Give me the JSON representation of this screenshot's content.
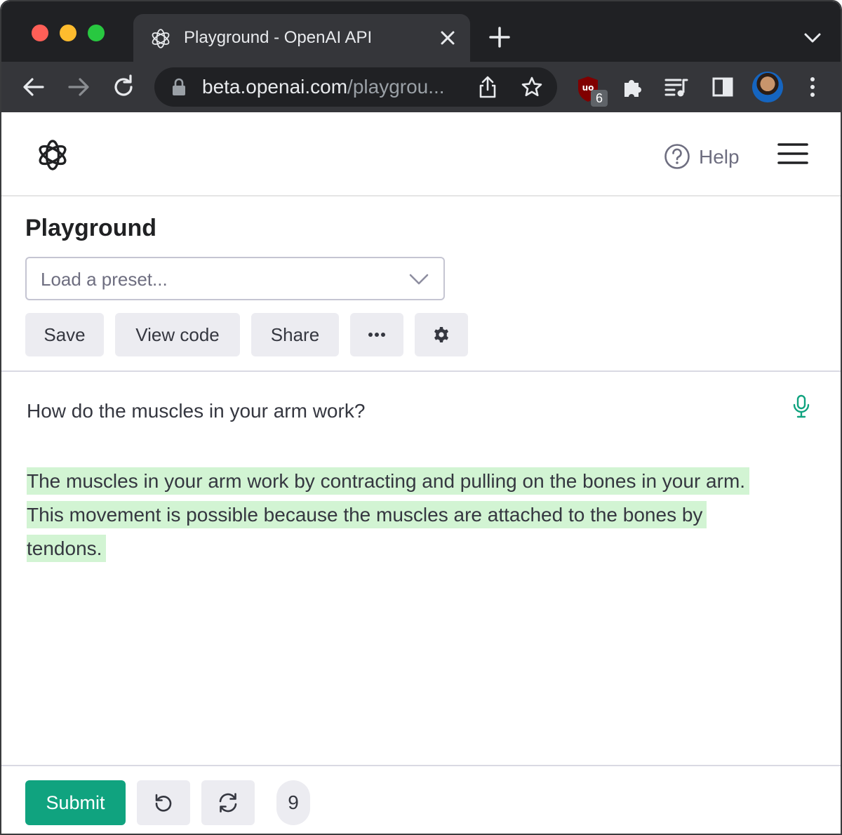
{
  "browser": {
    "tab_title": "Playground - OpenAI API",
    "url_host": "beta.openai.com",
    "url_path": "/playgrou...",
    "extension_badge": "6"
  },
  "header": {
    "help_label": "Help"
  },
  "controls": {
    "title": "Playground",
    "preset_placeholder": "Load a preset...",
    "save_label": "Save",
    "view_code_label": "View code",
    "share_label": "Share"
  },
  "editor": {
    "prompt": "How do the muscles in your arm work?",
    "completion": "The muscles in your arm work by contracting and pulling on the bones in your arm. This movement is possible because the muscles are attached to the bones by tendons."
  },
  "footer": {
    "submit_label": "Submit",
    "token_count": "9"
  },
  "colors": {
    "accent": "#10a37f",
    "highlight": "#d2f4d3",
    "chrome_dark": "#202124",
    "chrome_toolbar": "#35363a"
  },
  "icons": [
    "openai-logo-icon",
    "close-icon",
    "plus-icon",
    "chevron-down-icon",
    "back-arrow-icon",
    "forward-arrow-icon",
    "reload-icon",
    "lock-icon",
    "share-icon",
    "star-icon",
    "ublock-icon",
    "puzzle-icon",
    "media-queue-icon",
    "side-panel-icon",
    "kebab-menu-icon",
    "help-icon",
    "hamburger-icon",
    "ellipsis-icon",
    "gear-icon",
    "microphone-icon",
    "undo-icon",
    "regenerate-icon"
  ]
}
